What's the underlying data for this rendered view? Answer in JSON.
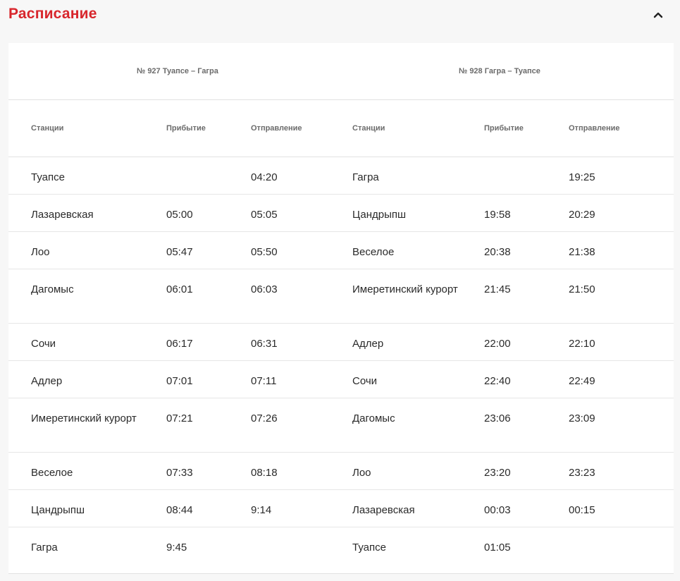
{
  "header": {
    "title": "Расписание",
    "toggle_icon": "chevron-up-icon"
  },
  "trains": [
    {
      "title": "№ 927 Туапсе – Гагра"
    },
    {
      "title": "№ 928 Гагра – Туапсе"
    }
  ],
  "columns": {
    "station": "Станции",
    "arrival": "Прибытие",
    "departure": "Отправление"
  },
  "rows": [
    {
      "s1": "Туапсе",
      "a1": "",
      "d1": "04:20",
      "s2": "Гагра",
      "a2": "",
      "d2": "19:25"
    },
    {
      "s1": "Лазаревская",
      "a1": "05:00",
      "d1": "05:05",
      "s2": "Цандрыпш",
      "a2": "19:58",
      "d2": "20:29"
    },
    {
      "s1": "Лоо",
      "a1": "05:47",
      "d1": "05:50",
      "s2": "Веселое",
      "a2": "20:38",
      "d2": "21:38"
    },
    {
      "s1": "Дагомыс",
      "a1": "06:01",
      "d1": "06:03",
      "s2": "Имеретинский курорт",
      "a2": "21:45",
      "d2": "21:50"
    },
    {
      "s1": "Сочи",
      "a1": "06:17",
      "d1": "06:31",
      "s2": "Адлер",
      "a2": "22:00",
      "d2": "22:10"
    },
    {
      "s1": "Адлер",
      "a1": "07:01",
      "d1": "07:11",
      "s2": "Сочи",
      "a2": "22:40",
      "d2": "22:49"
    },
    {
      "s1": "Имеретинский курорт",
      "a1": "07:21",
      "d1": "07:26",
      "s2": "Дагомыс",
      "a2": "23:06",
      "d2": "23:09"
    },
    {
      "s1": "Веселое",
      "a1": "07:33",
      "d1": "08:18",
      "s2": "Лоо",
      "a2": "23:20",
      "d2": "23:23"
    },
    {
      "s1": "Цандрыпш",
      "a1": "08:44",
      "d1": "9:14",
      "s2": "Лазаревская",
      "a2": "00:03",
      "d2": "00:15"
    },
    {
      "s1": "Гагра",
      "a1": "9:45",
      "d1": "",
      "s2": "Туапсе",
      "a2": "01:05",
      "d2": ""
    }
  ]
}
